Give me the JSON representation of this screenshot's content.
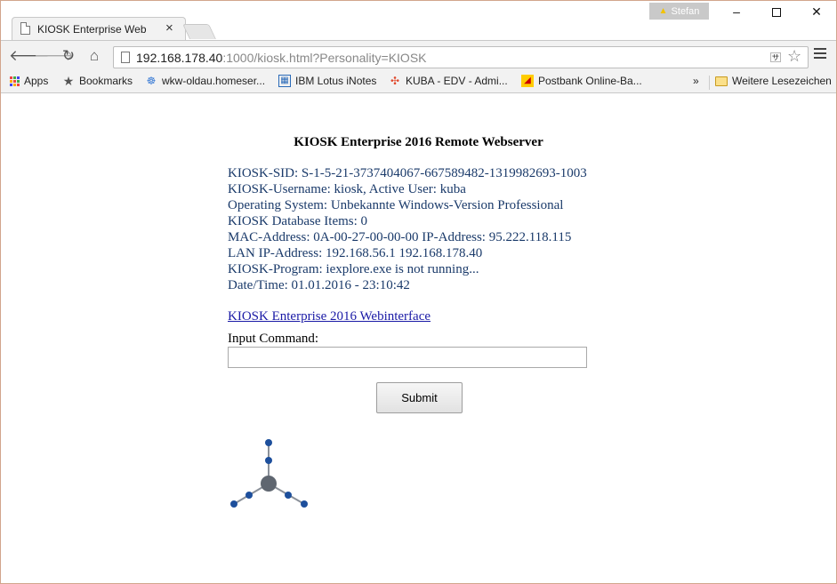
{
  "browser": {
    "tab_title": "KIOSK Enterprise Web",
    "tab_close": "×",
    "profile_name": "Stefan",
    "url_host": "192.168.178.40",
    "url_rest": ":1000/kiosk.html?Personality=KIOSK",
    "minimize": "–",
    "close": "✕"
  },
  "bookmarks": {
    "items": [
      {
        "label": "Apps",
        "icon": "apps-grid-icon"
      },
      {
        "label": "Bookmarks",
        "icon": "star-icon"
      },
      {
        "label": "wkw-oldau.homeser...",
        "icon": "network-icon"
      },
      {
        "label": "IBM Lotus iNotes",
        "icon": "inotes-icon"
      },
      {
        "label": "KUBA - EDV - Admi...",
        "icon": "joomla-icon"
      },
      {
        "label": "Postbank Online-Ba...",
        "icon": "postbank-icon"
      }
    ],
    "more": "»",
    "other_folder": "Weitere Lesezeichen"
  },
  "page": {
    "title": "KIOSK Enterprise 2016 Remote Webserver",
    "info_lines": [
      "KIOSK-SID: S-1-5-21-3737404067-667589482-1319982693-1003",
      "KIOSK-Username: kiosk, Active User: kuba",
      "Operating System: Unbekannte Windows-Version Professional",
      "KIOSK Database Items: 0",
      "MAC-Address: 0A-00-27-00-00-00 IP-Address: 95.222.118.115",
      "LAN IP-Address: 192.168.56.1 192.168.178.40",
      "KIOSK-Program: iexplore.exe is not running...",
      "Date/Time: 01.01.2016 - 23:10:42"
    ],
    "web_link": "KIOSK Enterprise 2016 Webinterface",
    "input_label": "Input Command:",
    "input_value": "",
    "submit_label": "Submit"
  },
  "colors": {
    "info_text": "#1a3a6a",
    "link": "#1a1aa6",
    "logo_node": "#1d4f9c",
    "logo_center": "#5f6670"
  }
}
